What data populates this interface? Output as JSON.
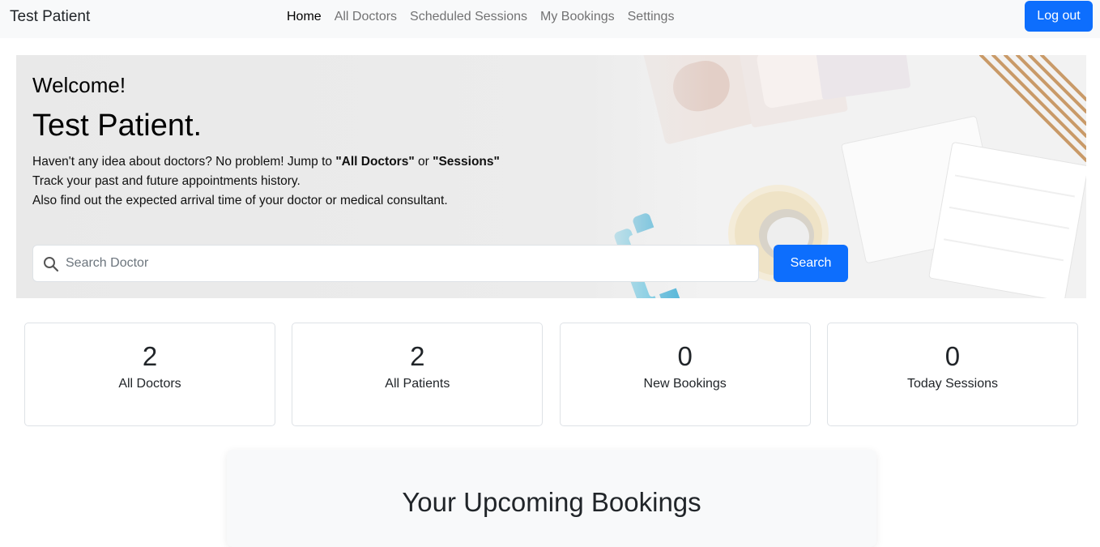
{
  "navbar": {
    "brand": "Test Patient",
    "links": [
      "Home",
      "All Doctors",
      "Scheduled Sessions",
      "My Bookings",
      "Settings"
    ],
    "active_link": "Home",
    "logout_label": "Log out"
  },
  "hero": {
    "welcome": "Welcome!",
    "name": "Test Patient.",
    "line1_prefix": "Haven't any idea about doctors? No problem! Jump to ",
    "line1_link1": "\"All Doctors\"",
    "line1_middle": " or ",
    "line1_link2": "\"Sessions\"",
    "line2": "Track your past and future appointments history.",
    "line3": "Also find out the expected arrival time of your doctor or medical consultant.",
    "search_placeholder": "Search Doctor",
    "search_value": "",
    "search_button": "Search"
  },
  "stats": [
    {
      "value": "2",
      "label": "All Doctors"
    },
    {
      "value": "2",
      "label": "All Patients"
    },
    {
      "value": "0",
      "label": "New Bookings"
    },
    {
      "value": "0",
      "label": "Today Sessions"
    }
  ],
  "bookings": {
    "title": "Your Upcoming Bookings"
  },
  "colors": {
    "primary": "#0d6efd",
    "navbar_bg": "#f8f9fa"
  },
  "icons": {
    "search": "search-icon"
  }
}
